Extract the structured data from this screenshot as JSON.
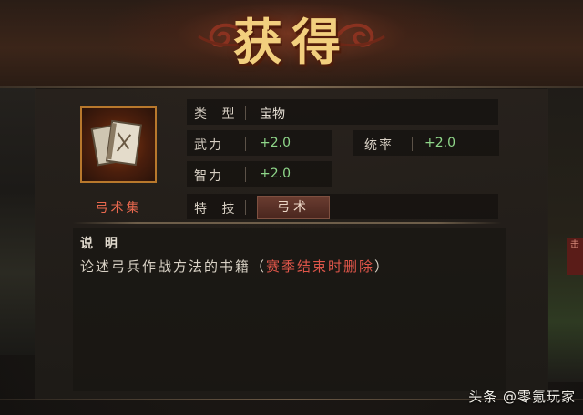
{
  "header": {
    "title": "获得"
  },
  "item": {
    "name": "弓术集",
    "icon": "book-scroll-icon"
  },
  "attributes": {
    "type_label": "类 型",
    "type_value": "宝物",
    "force_label": "武力",
    "force_value": "+2.0",
    "command_label": "统率",
    "command_value": "+2.0",
    "intellect_label": "智力",
    "intellect_value": "+2.0",
    "skill_label": "特 技",
    "skill_value": "弓术"
  },
  "description": {
    "heading": "说 明",
    "text": "论述弓兵作战方法的书籍",
    "paren_open": "（",
    "note": "赛季结束时删除",
    "paren_close": "）"
  },
  "side_tag": "击",
  "watermark": "头条 @零氪玩家",
  "colors": {
    "title_gold": "#f2cf7e",
    "item_name_red": "#e8684e",
    "stat_green": "#8fd78a",
    "note_red": "#e0564a",
    "frame_orange": "#b8782c"
  }
}
